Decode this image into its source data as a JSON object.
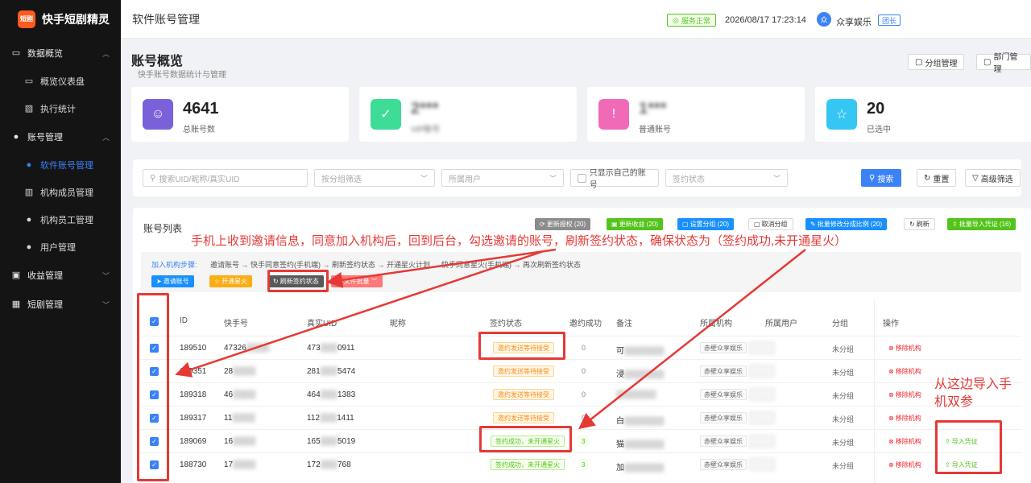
{
  "brand": {
    "logo_text": "短剧",
    "name": "快手短剧精灵"
  },
  "sidebar": {
    "groups": [
      {
        "label": "数据概览",
        "items": [
          "概览仪表盘",
          "执行统计"
        ]
      },
      {
        "label": "账号管理",
        "items": [
          "软件账号管理",
          "机构成员管理",
          "机构员工管理",
          "用户管理"
        ]
      },
      {
        "label": "收益管理"
      },
      {
        "label": "短剧管理"
      }
    ],
    "active_item": "软件账号管理"
  },
  "header": {
    "title": "软件账号管理",
    "status": "服务正常",
    "datetime": "2026/08/17 17:23:14",
    "avatar_text": "众",
    "user": "众享娱乐",
    "role": "团长"
  },
  "page": {
    "title": "账号概览",
    "subtitle": "快手账号数据统计与管理",
    "group_btn": "分组管理",
    "dept_btn": "部门管理"
  },
  "stats": [
    {
      "value": "4641",
      "label": "总账号数",
      "color": "#7b61d9"
    },
    {
      "value": "2***",
      "label": "VIP账号",
      "color": "#3ddc97"
    },
    {
      "value": "1***",
      "label": "普通账号",
      "color": "#f06ab8"
    },
    {
      "value": "20",
      "label": "已选中",
      "color": "#36c6f4"
    }
  ],
  "filters": {
    "search_placeholder": "搜索UID/昵称/真实UID",
    "group_placeholder": "按分组筛选",
    "owner_placeholder": "所属用户",
    "only_mine": "只显示自己的账号",
    "sign_placeholder": "签约状态",
    "search_btn": "搜索",
    "reset_btn": "重置",
    "advanced_btn": "高级筛选"
  },
  "list": {
    "title": "账号列表",
    "toolbar": [
      {
        "label": "更新授权 (20)",
        "color": "#8c8c8c"
      },
      {
        "label": "更新收益 (20)",
        "color": "#52c41a"
      },
      {
        "label": "设置分组 (20)",
        "color": "#1890ff"
      },
      {
        "label": "取消分组",
        "color": "outline"
      },
      {
        "label": "批量修改分成比例 (20)",
        "color": "#1890ff"
      },
      {
        "label": "刷新",
        "color": "outline"
      },
      {
        "label": "批量导入凭证 (16)",
        "color": "#52c41a"
      }
    ],
    "steps_label": "加入机构步骤:",
    "steps_text": "邀请账号 → 快手同意签约(手机端) → 刷新签约状态 → 开通星火计划 → 快手同意星火(手机端) → 再次刷新签约状态",
    "step_buttons": [
      {
        "label": "邀请账号",
        "color": "#1890ff"
      },
      {
        "label": "开通星火",
        "color": "#faad14"
      },
      {
        "label": "刷新签约状态",
        "color": "#595959"
      },
      {
        "label": "文件批量",
        "color": "#ff7875"
      }
    ],
    "columns": [
      "ID",
      "快手号",
      "真实UID",
      "昵称",
      "签约状态",
      "邀约成功",
      "备注",
      "所属机构",
      "所属用户",
      "分组",
      "操作"
    ],
    "rows": [
      {
        "id": "189510",
        "ks": "47326",
        "uid_a": "473",
        "uid_b": "0911",
        "status": "邀约发送等待接受",
        "invite": "0",
        "note": "可",
        "org": "赤壁众享娱乐",
        "group": "未分组",
        "action": "移除机构"
      },
      {
        "id": "189351",
        "ks": "28",
        "uid_a": "281",
        "uid_b": "5474",
        "status": "邀约发送等待接受",
        "invite": "0",
        "note": "浸",
        "org": "赤壁众享娱乐",
        "group": "未分组",
        "action": "移除机构"
      },
      {
        "id": "189318",
        "ks": "46",
        "uid_a": "464",
        "uid_b": "1383",
        "status": "邀约发送等待接受",
        "invite": "0",
        "note": "",
        "org": "赤壁众享娱乐",
        "group": "未分组",
        "action": "移除机构"
      },
      {
        "id": "189317",
        "ks": "11",
        "uid_a": "112",
        "uid_b": "1411",
        "status": "邀约发送等待接受",
        "invite": "0",
        "note": "白",
        "org": "赤壁众享娱乐",
        "group": "未分组",
        "action": "移除机构"
      },
      {
        "id": "189069",
        "ks": "16",
        "uid_a": "165",
        "uid_b": "5019",
        "status": "签约成功，未开通星火",
        "invite": "3",
        "note": "猫",
        "org": "赤壁众享娱乐",
        "group": "未分组",
        "action": "移除机构",
        "import": "导入凭证"
      },
      {
        "id": "188730",
        "ks": "17",
        "uid_a": "172",
        "uid_b": "768",
        "status": "签约成功，未开通星火",
        "invite": "3",
        "note": "加",
        "org": "赤壁众享娱乐",
        "group": "未分组",
        "action": "移除机构",
        "import": "导入凭证"
      }
    ]
  },
  "annotations": {
    "main": "手机上收到邀请信息，同意加入机构后，回到后台，勾选邀请的账号，刷新签约状态，确保状态为（签约成功,未开通星火）",
    "side": "从这边导入手机双参"
  }
}
